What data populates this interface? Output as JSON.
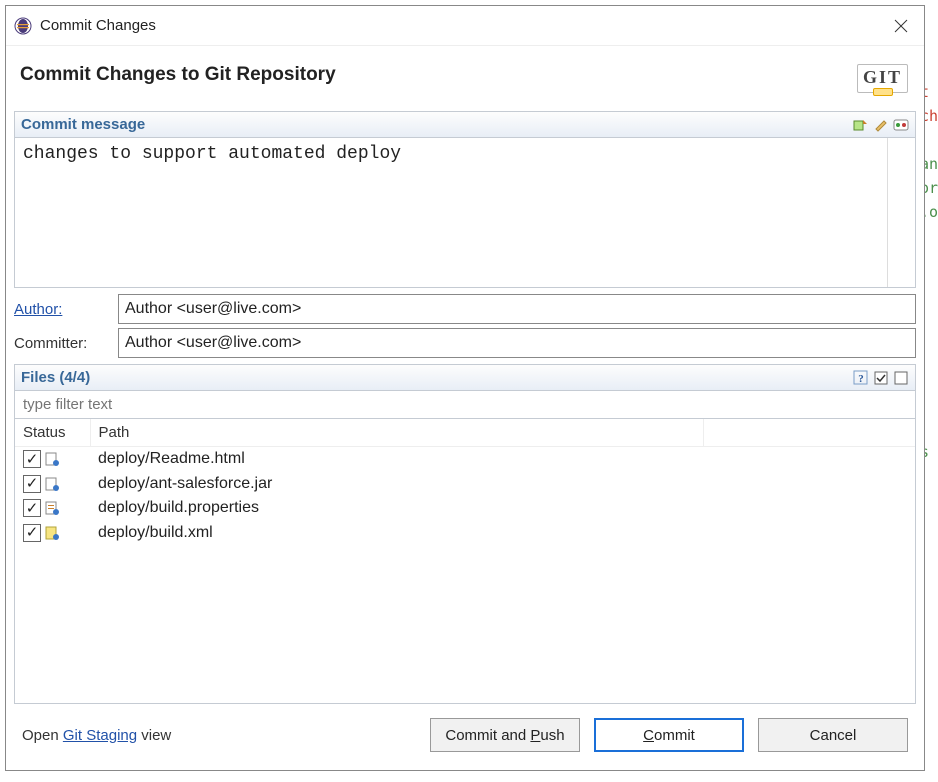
{
  "window": {
    "title": "Commit Changes"
  },
  "header": {
    "title": "Commit Changes to Git Repository",
    "git_logo_text": "GIT"
  },
  "commit_message": {
    "section_label": "Commit message",
    "value": "changes to support automated deploy",
    "toolbar_icons": [
      "amend-icon",
      "signoff-icon",
      "changeid-icon"
    ]
  },
  "author": {
    "label": "Author:",
    "value": "Author <user@live.com>"
  },
  "committer": {
    "label": "Committer:",
    "value": "Author <user@live.com>"
  },
  "files": {
    "section_label": "Files (4/4)",
    "filter_placeholder": "type filter text",
    "columns": {
      "status": "Status",
      "path": "Path"
    },
    "toolbar_icons": [
      "help-icon",
      "checkall-icon",
      "uncheckall-icon"
    ],
    "items": [
      {
        "checked": true,
        "icon": "file-html",
        "path": "deploy/Readme.html"
      },
      {
        "checked": true,
        "icon": "file-jar",
        "path": "deploy/ant-salesforce.jar"
      },
      {
        "checked": true,
        "icon": "file-props",
        "path": "deploy/build.properties"
      },
      {
        "checked": true,
        "icon": "file-xml",
        "path": "deploy/build.xml"
      }
    ]
  },
  "footer": {
    "open_prefix": "Open ",
    "staging_link": "Git Staging",
    "open_suffix": " view",
    "commit_push_label": "Commit and Push",
    "commit_push_mnemonic": "P",
    "commit_label": "Commit",
    "commit_mnemonic": "C",
    "cancel_label": "Cancel"
  },
  "background_code_fragments": {
    "t": "t",
    "ch": "ch",
    "an": "an",
    "or": "or",
    "dot": ".o",
    "s": "s"
  }
}
